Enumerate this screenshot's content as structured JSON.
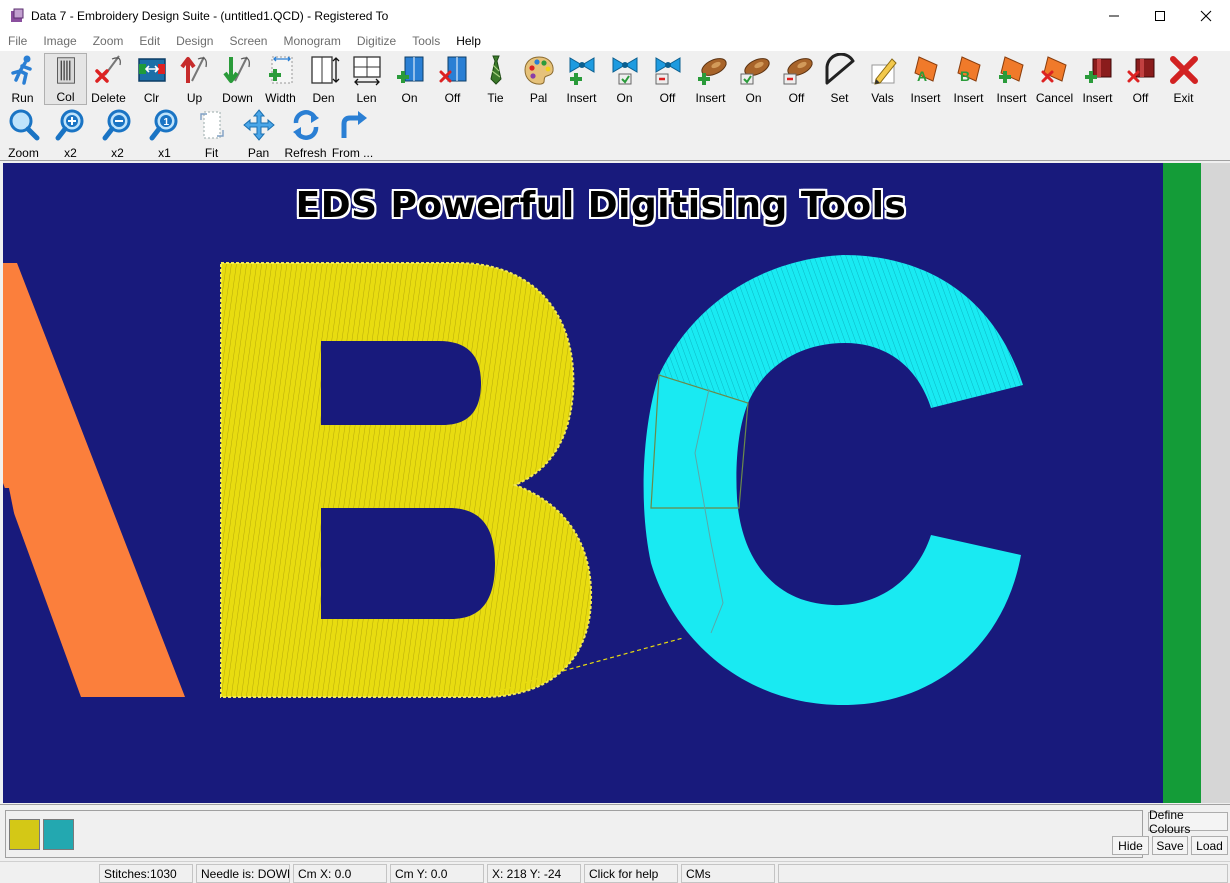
{
  "window": {
    "title": "Data 7 - Embroidery Design Suite - (untitled1.QCD) - Registered To"
  },
  "menu": [
    "File",
    "Image",
    "Zoom",
    "Edit",
    "Design",
    "Screen",
    "Monogram",
    "Digitize",
    "Tools",
    "Help"
  ],
  "toolbar1": [
    {
      "label": "Run",
      "icon": "runner-icon"
    },
    {
      "label": "Col",
      "icon": "columns-icon"
    },
    {
      "label": "Delete",
      "icon": "delete-needle-icon"
    },
    {
      "label": "Clr",
      "icon": "clear-colour-icon"
    },
    {
      "label": "Up",
      "icon": "needle-up-icon"
    },
    {
      "label": "Down",
      "icon": "needle-down-icon"
    },
    {
      "label": "Width",
      "icon": "width-icon"
    },
    {
      "label": "Den",
      "icon": "density-icon"
    },
    {
      "label": "Len",
      "icon": "length-icon"
    },
    {
      "label": "On",
      "icon": "split-on-icon"
    },
    {
      "label": "Off",
      "icon": "split-off-icon"
    },
    {
      "label": "Tie",
      "icon": "tie-icon"
    },
    {
      "label": "Pal",
      "icon": "palette-icon"
    },
    {
      "label": "Insert",
      "icon": "bow-insert-icon"
    },
    {
      "label": "On",
      "icon": "bow-on-icon"
    },
    {
      "label": "Off",
      "icon": "bow-off-icon"
    },
    {
      "label": "Insert",
      "icon": "bobbin-insert-icon"
    },
    {
      "label": "On",
      "icon": "bobbin-on-icon"
    },
    {
      "label": "Off",
      "icon": "bobbin-off-icon"
    },
    {
      "label": "Set",
      "icon": "protractor-icon"
    },
    {
      "label": "Vals",
      "icon": "pencil-icon"
    },
    {
      "label": "Insert",
      "icon": "letter-a-icon"
    },
    {
      "label": "Insert",
      "icon": "letter-b-icon"
    },
    {
      "label": "Insert",
      "icon": "cut-insert-icon"
    },
    {
      "label": "Cancel",
      "icon": "cut-cancel-icon"
    },
    {
      "label": "Insert",
      "icon": "trim-insert-icon"
    },
    {
      "label": "Off",
      "icon": "trim-off-icon"
    },
    {
      "label": "Exit",
      "icon": "exit-x-icon"
    }
  ],
  "toolbar2": [
    {
      "label": "Zoom",
      "icon": "zoom-icon"
    },
    {
      "label": "x2",
      "icon": "zoom-in-icon"
    },
    {
      "label": "x2",
      "icon": "zoom-out-icon"
    },
    {
      "label": "x1",
      "icon": "zoom-one-icon"
    },
    {
      "label": "Fit",
      "icon": "fit-page-icon"
    },
    {
      "label": "Pan",
      "icon": "pan-arrows-icon"
    },
    {
      "label": "Refresh",
      "icon": "refresh-icon"
    },
    {
      "label": "From ...",
      "icon": "from-arrow-icon"
    }
  ],
  "canvas": {
    "banner": "EDS Powerful Digitising Tools"
  },
  "colours": {
    "swatches": [
      "#d4c816",
      "#23a8b0"
    ],
    "define_label": "Define Colours",
    "hide_label": "Hide",
    "save_label": "Save",
    "load_label": "Load"
  },
  "status": {
    "stitches": "Stitches:1030",
    "needle": "Needle is: DOWN",
    "cmx": "Cm X: 0.0",
    "cmy": "Cm Y: 0.0",
    "xy": "X: 218 Y: -24",
    "help": "Click for help",
    "units": "CMs"
  }
}
